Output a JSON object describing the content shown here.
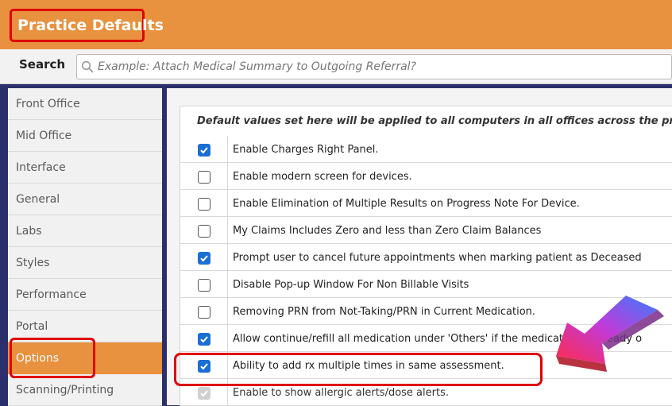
{
  "window": {
    "title": "Practice Defaults"
  },
  "search": {
    "label": "Search",
    "placeholder": "Example: Attach Medical Summary to Outgoing Referral?"
  },
  "sidebar": {
    "items": [
      {
        "label": "Front Office"
      },
      {
        "label": "Mid Office"
      },
      {
        "label": "Interface"
      },
      {
        "label": "General"
      },
      {
        "label": "Labs"
      },
      {
        "label": "Styles"
      },
      {
        "label": "Performance"
      },
      {
        "label": "Portal"
      },
      {
        "label": "Options",
        "active": true
      },
      {
        "label": "Scanning/Printing"
      }
    ]
  },
  "content": {
    "note": "Default values set here will be applied to all computers in all offices across the practice",
    "options": [
      {
        "label": "Enable Charges Right Panel.",
        "checked": true
      },
      {
        "label": "Enable modern screen for devices.",
        "checked": false
      },
      {
        "label": "Enable Elimination of Multiple Results on Progress Note For Device.",
        "checked": false
      },
      {
        "label": "My Claims Includes Zero and less than Zero Claim Balances",
        "checked": false
      },
      {
        "label": "Prompt user to cancel future appointments when marking patient as Deceased",
        "checked": true
      },
      {
        "label": "Disable Pop-up Window For Non Billable Visits",
        "checked": false
      },
      {
        "label": "Removing PRN from Not-Taking/PRN in Current Medication.",
        "checked": false
      },
      {
        "label": "Allow continue/refill all medication under 'Others' if the medication is already o",
        "checked": true
      },
      {
        "label": "Ability to add rx multiple times in same assessment.",
        "checked": true,
        "highlighted": true
      },
      {
        "label": "Enable to show allergic alerts/dose alerts.",
        "checked": true,
        "disabled": true
      }
    ]
  },
  "colors": {
    "header": "#e8913f",
    "active_item": "#e8913f",
    "checkbox_checked": "#1a6fd4",
    "annotation_red": "#e00000",
    "background": "#2b2f6b"
  },
  "icons": {
    "search": "search-icon",
    "check": "check-icon",
    "annotation_arrow": "arrow-icon"
  }
}
